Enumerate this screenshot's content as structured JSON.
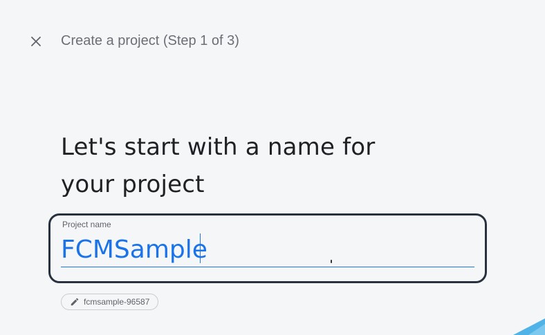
{
  "header": {
    "close_icon": "close-icon",
    "step_title": "Create a project (Step 1 of 3)"
  },
  "main": {
    "headline_line1": "Let's start with a name for",
    "headline_line2": "your project",
    "project_name_field": {
      "label": "Project name",
      "value": "FCMSample"
    },
    "project_id_chip": {
      "icon": "pencil-icon",
      "value": "fcmsample-96587"
    }
  },
  "colors": {
    "background": "#f5f6f8",
    "accent": "#1a73e8",
    "focus_ring": "#29313f",
    "corner_decoration": "#4fb3e8"
  }
}
